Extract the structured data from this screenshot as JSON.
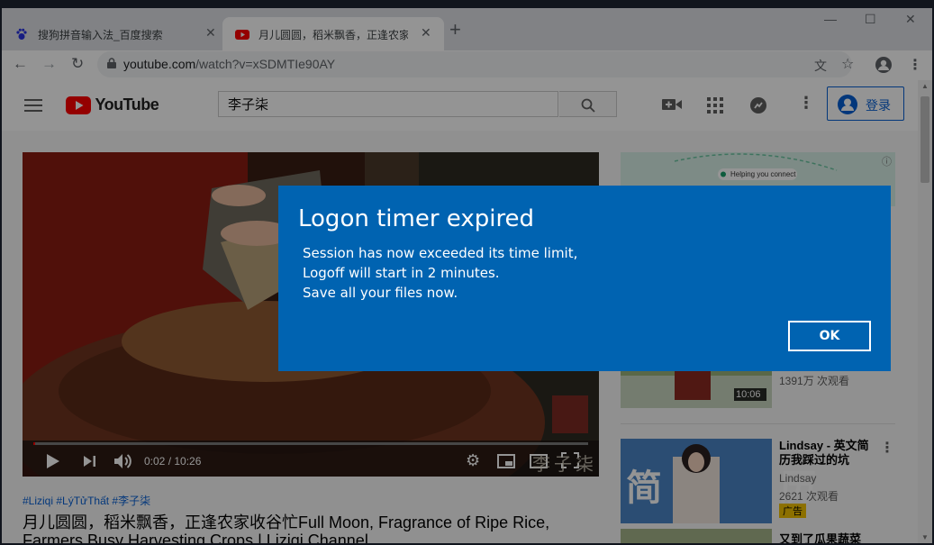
{
  "browser": {
    "tabs": [
      {
        "title": "搜狗拼音输入法_百度搜索",
        "favicon": "baidu-paw-icon"
      },
      {
        "title": "月儿圆圆，稻米飘香，正逢农家收谷忙",
        "favicon": "youtube-icon"
      }
    ],
    "url_host": "youtube.com",
    "url_path": "/watch?v=xSDMTIe90AY",
    "colors": {
      "tabstrip": "#dee1e6"
    }
  },
  "youtube": {
    "logo_text": "YouTube",
    "search_value": "李子柒",
    "signin_label": "登录",
    "player": {
      "time": "0:02 / 10:26",
      "watermark": "李子柒",
      "progress": 0.003
    },
    "hashtags": "#Liziqi #LýTửThất #李子柒",
    "video_title_line1": "月儿圆圆，稻米飘香，正逢农家收谷忙Full Moon, Fragrance of Ripe Rice,",
    "video_title_line2": "Farmers Busy Harvesting Crops | Liziqi Channel",
    "ad_banner": "Helping you connect",
    "sidebar": [
      {
        "views": "1391万 次观看",
        "duration": "10:06"
      },
      {
        "title": "Lindsay - 英文简历我踩过的坑",
        "channel": "Lindsay",
        "views": "2621 次观看",
        "badge": "广告",
        "thumb_text": "简 历"
      },
      {
        "title": "又到了瓜果蔬菜"
      }
    ]
  },
  "dialog": {
    "title": "Logon timer expired",
    "lines": [
      "Session has now exceeded its time limit,",
      "Logoff will start in 2 minutes.",
      "Save all your files now."
    ],
    "ok_label": "OK",
    "color": "#0063b1"
  }
}
